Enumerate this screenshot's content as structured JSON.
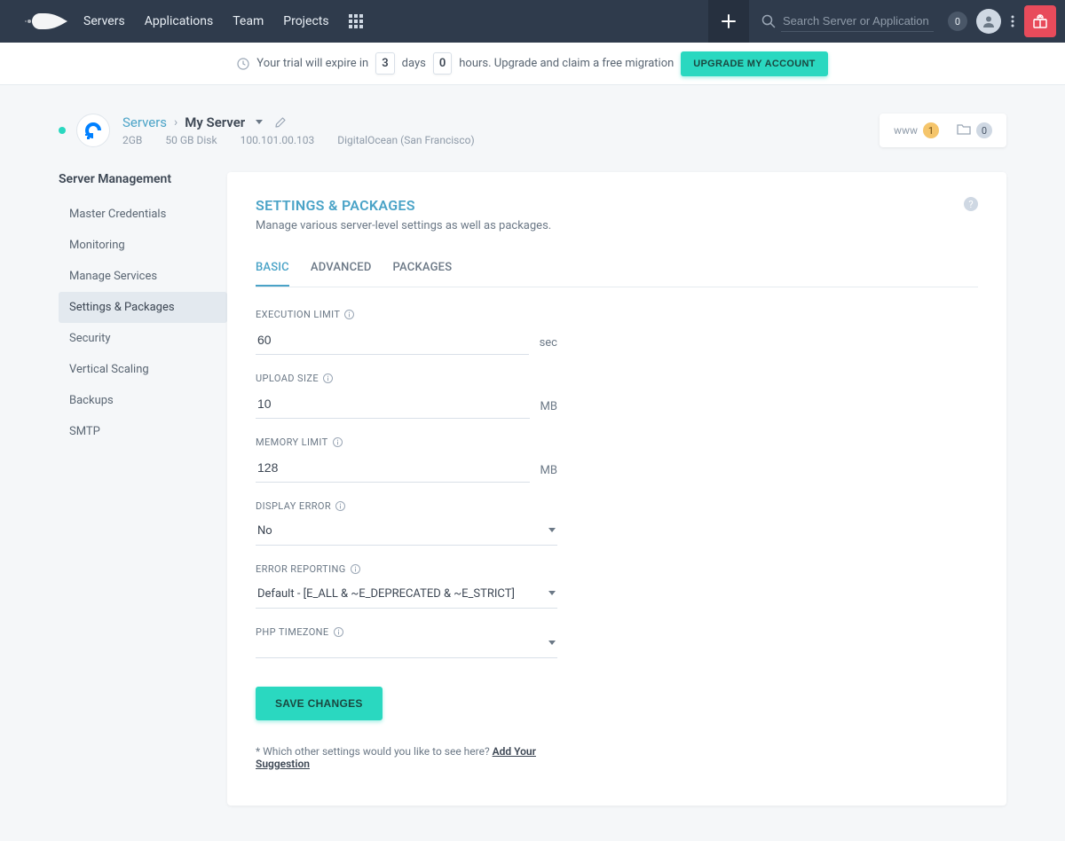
{
  "nav": {
    "links": [
      "Servers",
      "Applications",
      "Team",
      "Projects"
    ],
    "search_placeholder": "Search Server or Application",
    "notif_count": "0"
  },
  "trial": {
    "prefix": "Your trial will expire in",
    "days_value": "3",
    "days_label": "days",
    "hours_value": "0",
    "hours_suffix": "hours. Upgrade and claim a free migration",
    "upgrade_btn": "UPGRADE MY ACCOUNT"
  },
  "server": {
    "breadcrumb_root": "Servers",
    "name": "My Server",
    "specs": [
      "2GB",
      "50 GB Disk",
      "100.101.00.103",
      "DigitalOcean (San Francisco)"
    ],
    "www_label": "www",
    "www_count": "1",
    "proj_count": "0"
  },
  "sidebar": {
    "title": "Server Management",
    "items": [
      "Master Credentials",
      "Monitoring",
      "Manage Services",
      "Settings & Packages",
      "Security",
      "Vertical Scaling",
      "Backups",
      "SMTP"
    ]
  },
  "panel": {
    "title": "SETTINGS & PACKAGES",
    "subtitle": "Manage various server-level settings as well as packages.",
    "help_glyph": "?",
    "tabs": [
      "BASIC",
      "ADVANCED",
      "PACKAGES"
    ],
    "form": {
      "execution_limit": {
        "label": "EXECUTION LIMIT",
        "value": "60",
        "unit": "sec"
      },
      "upload_size": {
        "label": "UPLOAD SIZE",
        "value": "10",
        "unit": "MB"
      },
      "memory_limit": {
        "label": "MEMORY LIMIT",
        "value": "128",
        "unit": "MB"
      },
      "display_error": {
        "label": "DISPLAY ERROR",
        "value": "No"
      },
      "error_reporting": {
        "label": "ERROR REPORTING",
        "value": "Default - [E_ALL & ~E_DEPRECATED & ~E_STRICT]"
      },
      "php_timezone": {
        "label": "PHP TIMEZONE",
        "value": ""
      }
    },
    "save_btn": "SAVE CHANGES",
    "suggestion_prefix": "* Which other settings would you like to see here? ",
    "suggestion_link": "Add Your Suggestion"
  }
}
